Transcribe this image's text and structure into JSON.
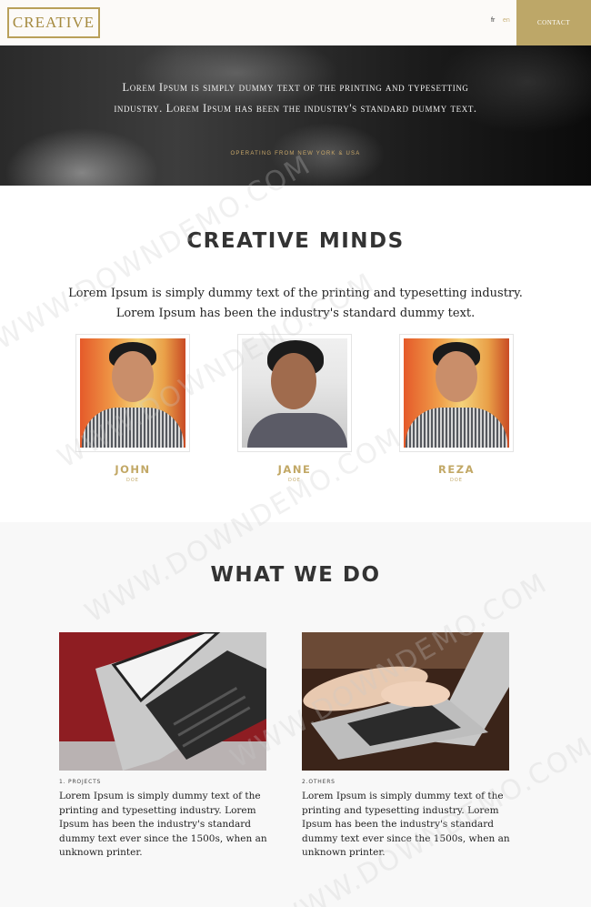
{
  "header": {
    "logo": "CREATIVE",
    "lang_fr": "fr",
    "lang_en": "en",
    "contact_label": "CONTACT"
  },
  "hero": {
    "text": "Lorem Ipsum is simply dummy text of the printing and typesetting industry. Lorem Ipsum has been the industry's standard dummy text.",
    "subtext": "OPERATING FROM NEW YORK & USA"
  },
  "minds": {
    "title": "CREATIVE MINDS",
    "description": "Lorem Ipsum is simply dummy text of the printing and typesetting industry. Lorem Ipsum has been the industry's standard dummy text.",
    "members": [
      {
        "name": "JOHN",
        "role": "DOE"
      },
      {
        "name": "JANE",
        "role": "DOE"
      },
      {
        "name": "REZA",
        "role": "DOE"
      }
    ]
  },
  "services": {
    "title": "WHAT WE DO",
    "cards": [
      {
        "label": "1. PROJECTS",
        "text": "Lorem Ipsum is simply dummy text of the printing and typesetting industry. Lorem Ipsum has been the industry's standard dummy text ever since the 1500s, when an unknown printer."
      },
      {
        "label": "2.OTHERS",
        "text": "Lorem Ipsum is simply dummy text of the printing and typesetting industry. Lorem Ipsum has been the industry's standard dummy text ever since the 1500s, when an unknown printer."
      }
    ]
  },
  "watermark": "WWW.DOWNDEMO.COM",
  "colors": {
    "accent": "#bda768",
    "accent_text": "#c2a866"
  }
}
